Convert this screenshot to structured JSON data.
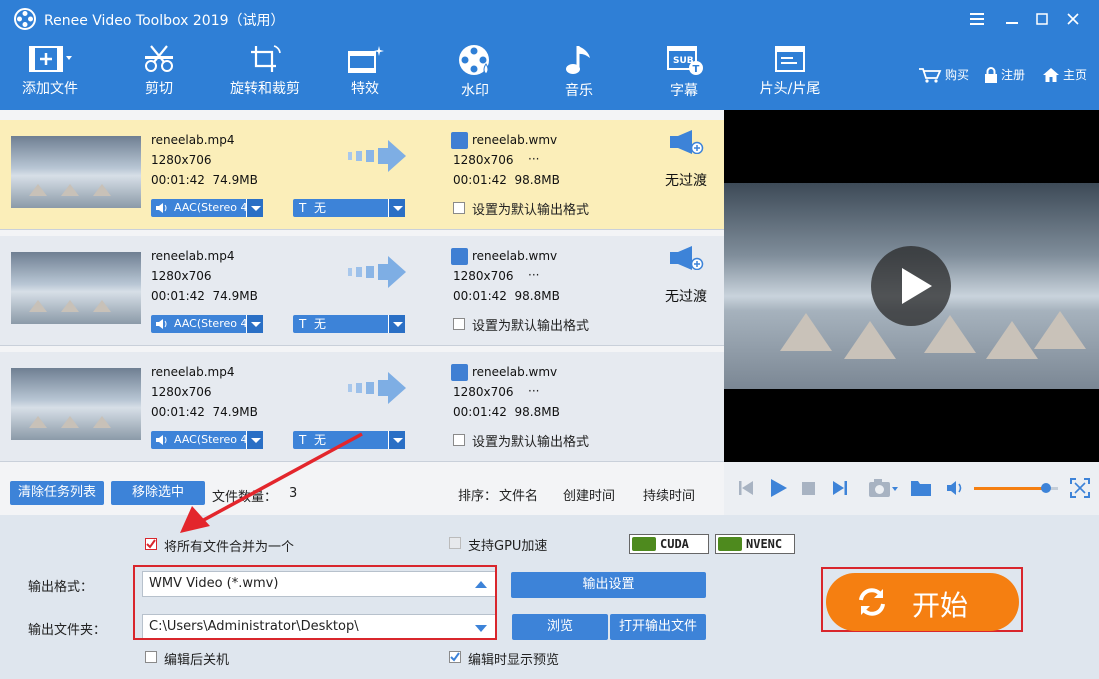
{
  "window": {
    "title": "Renee Video Toolbox 2019（试用）",
    "controls": [
      "menu-icon",
      "minimize-icon",
      "maximize-icon",
      "close-icon"
    ]
  },
  "toolbar": {
    "items": [
      {
        "label": "添加文件",
        "icon": "add-file-icon"
      },
      {
        "label": "剪切",
        "icon": "scissors-icon"
      },
      {
        "label": "旋转和裁剪",
        "icon": "crop-rotate-icon"
      },
      {
        "label": "特效",
        "icon": "effects-icon"
      },
      {
        "label": "水印",
        "icon": "watermark-icon"
      },
      {
        "label": "音乐",
        "icon": "music-icon"
      },
      {
        "label": "字幕",
        "icon": "subtitle-icon"
      },
      {
        "label": "片头/片尾",
        "icon": "intro-outro-icon"
      }
    ],
    "links": [
      {
        "label": "购买",
        "icon": "cart-icon"
      },
      {
        "label": "注册",
        "icon": "lock-icon"
      },
      {
        "label": "主页",
        "icon": "home-icon"
      }
    ]
  },
  "files": [
    {
      "src_name": "reneelab.mp4",
      "src_res": "1280x706",
      "src_dur_size": "00:01:42  74.9MB",
      "out_name": "reneelab.wmv",
      "out_res": "1280x706",
      "out_more": "···",
      "out_dur_size": "00:01:42  98.8MB",
      "audio": "AAC(Stereo 4",
      "subtitle": "T  无",
      "transition": "无过渡",
      "default_label": "设置为默认输出格式",
      "selected": true
    },
    {
      "src_name": "reneelab.mp4",
      "src_res": "1280x706",
      "src_dur_size": "00:01:42  74.9MB",
      "out_name": "reneelab.wmv",
      "out_res": "1280x706",
      "out_more": "···",
      "out_dur_size": "00:01:42  98.8MB",
      "audio": "AAC(Stereo 4",
      "subtitle": "T  无",
      "transition": "无过渡",
      "default_label": "设置为默认输出格式",
      "selected": false
    },
    {
      "src_name": "reneelab.mp4",
      "src_res": "1280x706",
      "src_dur_size": "00:01:42  74.9MB",
      "out_name": "reneelab.wmv",
      "out_res": "1280x706",
      "out_more": "···",
      "out_dur_size": "00:01:42  98.8MB",
      "audio": "AAC(Stereo 4",
      "subtitle": "T  无",
      "transition": "",
      "default_label": "设置为默认输出格式",
      "selected": false
    }
  ],
  "listbar": {
    "clear_label": "清除任务列表",
    "remove_label": "移除选中",
    "count_label": "文件数量：",
    "count_value": "3",
    "sort_label": "排序：",
    "sort_options": [
      "文件名",
      "创建时间",
      "持续时间"
    ]
  },
  "player": {
    "volume_fraction": 0.86
  },
  "options": {
    "merge_label": "将所有文件合并为一个",
    "merge_checked": true,
    "gpu_label": "支持GPU加速",
    "gpu_checked": false,
    "cuda_label": "CUDA",
    "nvenc_label": "NVENC",
    "format_label": "输出格式：",
    "format_value": "WMV Video (*.wmv)",
    "folder_label": "输出文件夹：",
    "folder_value": "C:\\Users\\Administrator\\Desktop\\",
    "settings_label": "输出设置",
    "browse_label": "浏览",
    "open_folder_label": "打开输出文件",
    "shutdown_label": "编辑后关机",
    "shutdown_checked": false,
    "preview_label": "编辑时显示预览",
    "preview_checked": true,
    "start_label": "开始"
  },
  "colors": {
    "accent": "#2f7fd6",
    "start": "#f57f11",
    "highlight": "#d9262c",
    "selected_row": "#fbeeb9"
  }
}
